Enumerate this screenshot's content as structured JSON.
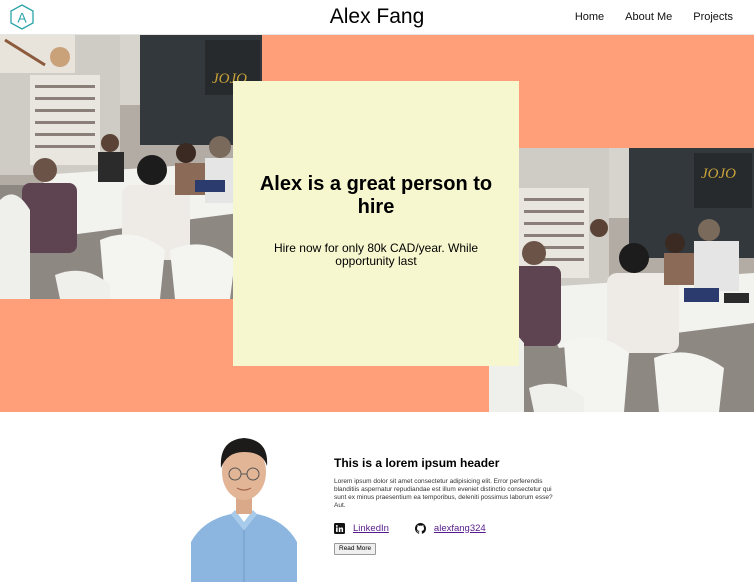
{
  "header": {
    "logo_letter": "A",
    "site_title": "Alex Fang",
    "nav": [
      {
        "label": "Home"
      },
      {
        "label": "About Me"
      },
      {
        "label": "Projects"
      }
    ]
  },
  "hero": {
    "headline": "Alex is a great person to hire",
    "subtext": "Hire now for only 80k CAD/year. While opportunity last"
  },
  "about": {
    "header": "This is a lorem ipsum header",
    "body": "Lorem ipsum dolor sit amet consectetur adipisicing elit. Error perferendis blanditiis aspernatur repudiandae est illum eveniet distinctio consectetur qui sunt ex minus praesentium ea temporibus, deleniti possimus laborum esse? Aut.",
    "links": [
      {
        "icon": "linkedin-icon",
        "label": "LinkedIn"
      },
      {
        "icon": "github-icon",
        "label": "alexfang324"
      }
    ],
    "button_label": "Read More"
  },
  "colors": {
    "hero_background": "#ff9f7a",
    "hero_card": "#f7f7cf",
    "logo": "#2aa3a8",
    "link": "#551a8b"
  }
}
